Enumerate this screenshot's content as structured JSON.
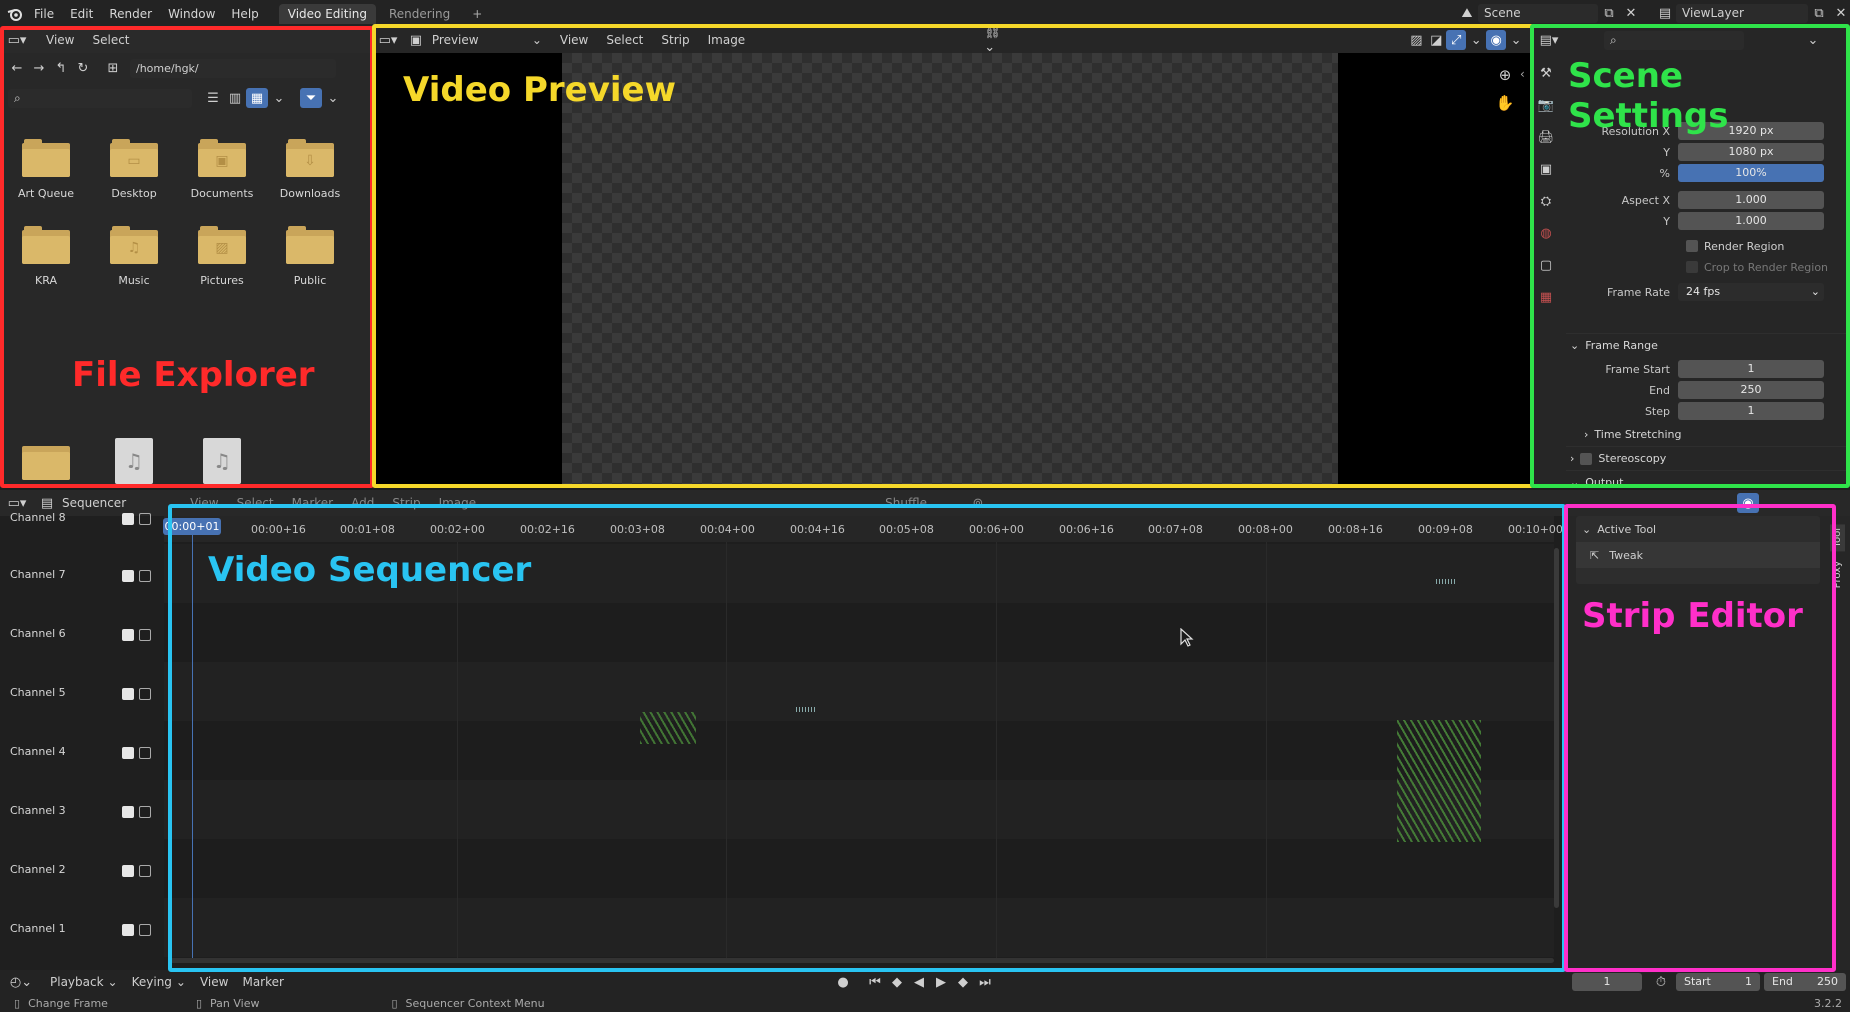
{
  "topbar": {
    "menus": [
      "File",
      "Edit",
      "Render",
      "Window",
      "Help"
    ],
    "workspaces": [
      {
        "label": "Video Editing",
        "active": true
      },
      {
        "label": "Rendering",
        "active": false
      }
    ],
    "add_workspace": "+",
    "scene_field": "Scene",
    "viewlayer_field": "ViewLayer"
  },
  "file_explorer": {
    "menus": [
      "View",
      "Select"
    ],
    "path": "/home/hgk/",
    "search_placeholder": "",
    "folders": [
      {
        "label": "Art Queue",
        "glyph": ""
      },
      {
        "label": "Desktop",
        "glyph": "▭"
      },
      {
        "label": "Documents",
        "glyph": "▣"
      },
      {
        "label": "Downloads",
        "glyph": "⇩"
      },
      {
        "label": "KRA",
        "glyph": ""
      },
      {
        "label": "Music",
        "glyph": "♫"
      },
      {
        "label": "Pictures",
        "glyph": "▨"
      },
      {
        "label": "Public",
        "glyph": ""
      }
    ],
    "annotation": "File Explorer",
    "annotation_color": "#ff2a2a"
  },
  "preview": {
    "mode_label": "Preview",
    "menus": [
      "View",
      "Select",
      "Strip",
      "Image"
    ],
    "annotation": "Video Preview",
    "annotation_color": "#f5d82a"
  },
  "scene_settings": {
    "annotation": "Scene Settings",
    "annotation_color": "#2fe34a",
    "resolution_x_label": "Resolution X",
    "resolution_x": "1920 px",
    "resolution_y_label": "Y",
    "resolution_y": "1080 px",
    "resolution_pct_label": "%",
    "resolution_pct": "100%",
    "aspect_x_label": "Aspect X",
    "aspect_x": "1.000",
    "aspect_y_label": "Y",
    "aspect_y": "1.000",
    "render_region": "Render Region",
    "crop_region": "Crop to Render Region",
    "frame_rate_label": "Frame Rate",
    "frame_rate": "24 fps",
    "frame_range_header": "Frame Range",
    "frame_start_label": "Frame Start",
    "frame_start": "1",
    "frame_end_label": "End",
    "frame_end": "250",
    "frame_step_label": "Step",
    "frame_step": "1",
    "time_stretching": "Time Stretching",
    "stereoscopy": "Stereoscopy",
    "output": "Output"
  },
  "sequencer": {
    "editor_label": "Sequencer",
    "menus": [
      "View",
      "Select",
      "Marker",
      "Add",
      "Strip",
      "Image"
    ],
    "shuffle_label": "Shuffle",
    "annotation": "Video Sequencer",
    "annotation_color": "#29c4f2",
    "current_time": "00:00+01",
    "timecodes": [
      "00:00+16",
      "00:01+08",
      "00:02+00",
      "00:02+16",
      "00:03+08",
      "00:04+00",
      "00:04+16",
      "00:05+08",
      "00:06+00",
      "00:06+16",
      "00:07+08",
      "00:08+00",
      "00:08+16",
      "00:09+08",
      "00:10+00"
    ],
    "channels": [
      "Channel 8",
      "Channel 7",
      "Channel 6",
      "Channel 5",
      "Channel 4",
      "Channel 3",
      "Channel 2",
      "Channel 1"
    ]
  },
  "strip_editor": {
    "annotation": "Strip Editor",
    "annotation_color": "#ff2fc9",
    "active_tool_header": "Active Tool",
    "tool_name": "Tweak",
    "side_tabs": [
      "Tool",
      "Proxy"
    ]
  },
  "timeline": {
    "menus": [
      "Playback",
      "Keying",
      "View",
      "Marker"
    ],
    "current_frame": "1",
    "start_label": "Start",
    "start": "1",
    "end_label": "End",
    "end": "250"
  },
  "statusbar": {
    "hints": [
      "Change Frame",
      "Pan View",
      "Sequencer Context Menu"
    ],
    "version": "3.2.2"
  }
}
